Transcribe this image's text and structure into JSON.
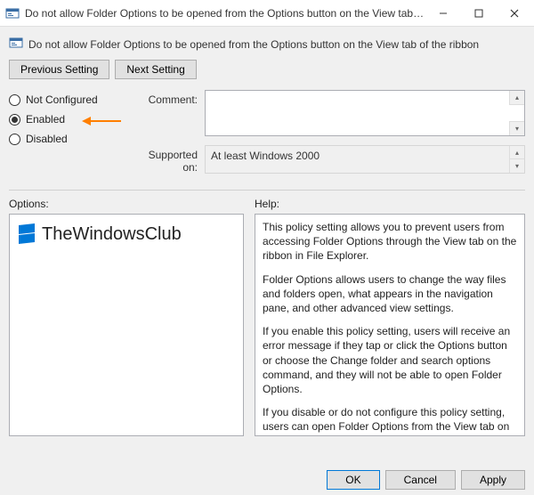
{
  "window": {
    "title": "Do not allow Folder Options to be opened from the Options button on the View tab of the ribbon"
  },
  "header": {
    "text": "Do not allow Folder Options to be opened from the Options button on the View tab of the ribbon"
  },
  "nav": {
    "previous": "Previous Setting",
    "next": "Next Setting"
  },
  "radios": {
    "not_configured": "Not Configured",
    "enabled": "Enabled",
    "disabled": "Disabled",
    "selected": "enabled"
  },
  "form": {
    "comment_label": "Comment:",
    "comment_value": "",
    "supported_label": "Supported on:",
    "supported_value": "At least Windows 2000"
  },
  "lower": {
    "options_label": "Options:",
    "help_label": "Help:",
    "help_paragraphs": [
      "This policy setting allows you to prevent users from accessing Folder Options through the View tab on the ribbon in File Explorer.",
      "Folder Options allows users to change the way files and folders open, what appears in the navigation pane, and other advanced view settings.",
      "If you enable this policy setting, users will receive an error message if they tap or click the Options button or choose the Change folder and search options command, and they will not be able to open Folder Options.",
      "If you disable or do not configure this policy setting, users can open Folder Options from the View tab on the ribbon."
    ]
  },
  "watermark": {
    "text": "TheWindowsClub"
  },
  "footer": {
    "ok": "OK",
    "cancel": "Cancel",
    "apply": "Apply"
  }
}
